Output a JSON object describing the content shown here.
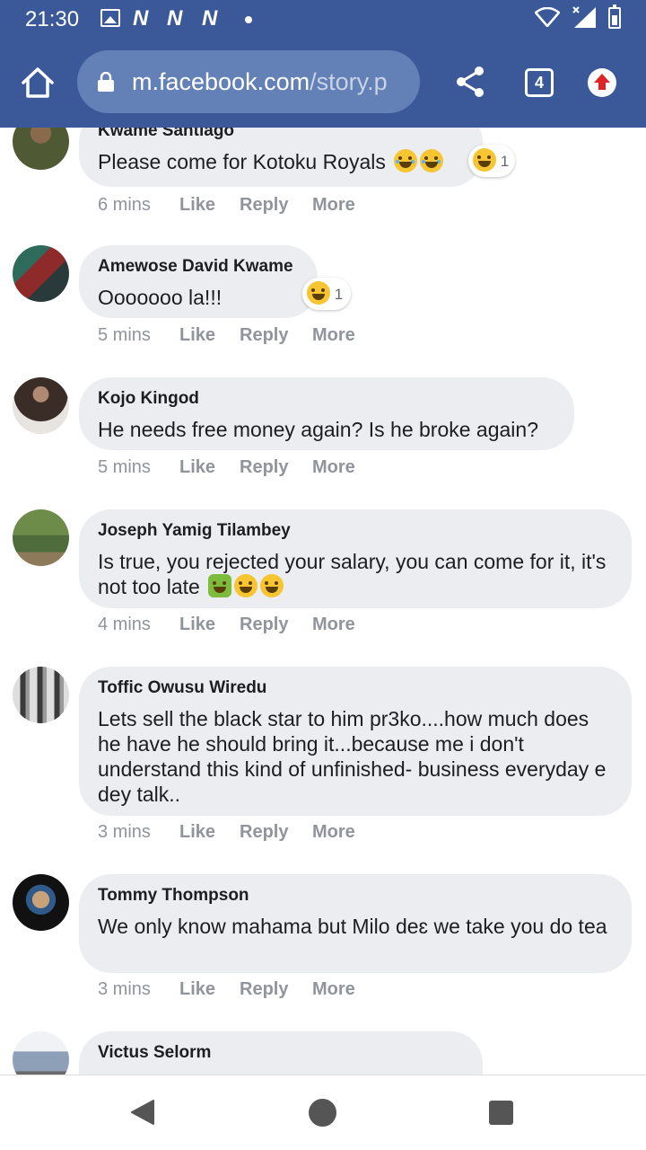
{
  "status_bar": {
    "time": "21:30",
    "notifications": [
      "image-icon",
      "N",
      "N",
      "N",
      "dot"
    ]
  },
  "browser": {
    "url_domain": "m.facebook.com",
    "url_path": "/story.p",
    "tab_count": "4",
    "colors": {
      "header": "#3b5998",
      "urlbar": "#6380b7"
    }
  },
  "comments": [
    {
      "author": "Kwame Santiago",
      "text": "Please come for Kotoku Royals",
      "time": "6 mins",
      "reaction_count": "1"
    },
    {
      "author": "Amewose David Kwame",
      "text": "Ooooooo la!!!",
      "time": "5 mins",
      "reaction_count": "1"
    },
    {
      "author": "Kojo Kingod",
      "text": "He needs free money again? Is he broke again?",
      "time": "5 mins"
    },
    {
      "author": "Joseph Yamig Tilambey",
      "text": "Is true, you rejected your salary, you can come for it, it's not too late",
      "time": "4 mins"
    },
    {
      "author": "Toffic Owusu Wiredu",
      "text": "Lets sell the black star to him pr3ko....how much does he have he should bring it...because me i don't understand this kind of unfinished- business everyday e dey talk..",
      "time": "3 mins"
    },
    {
      "author": "Tommy Thompson",
      "text": "We only know mahama but Milo deɛ we take you do tea",
      "time": "3 mins"
    },
    {
      "author": "Victus Selorm",
      "text": ""
    }
  ],
  "actions": {
    "like": "Like",
    "reply": "Reply",
    "more": "More"
  }
}
